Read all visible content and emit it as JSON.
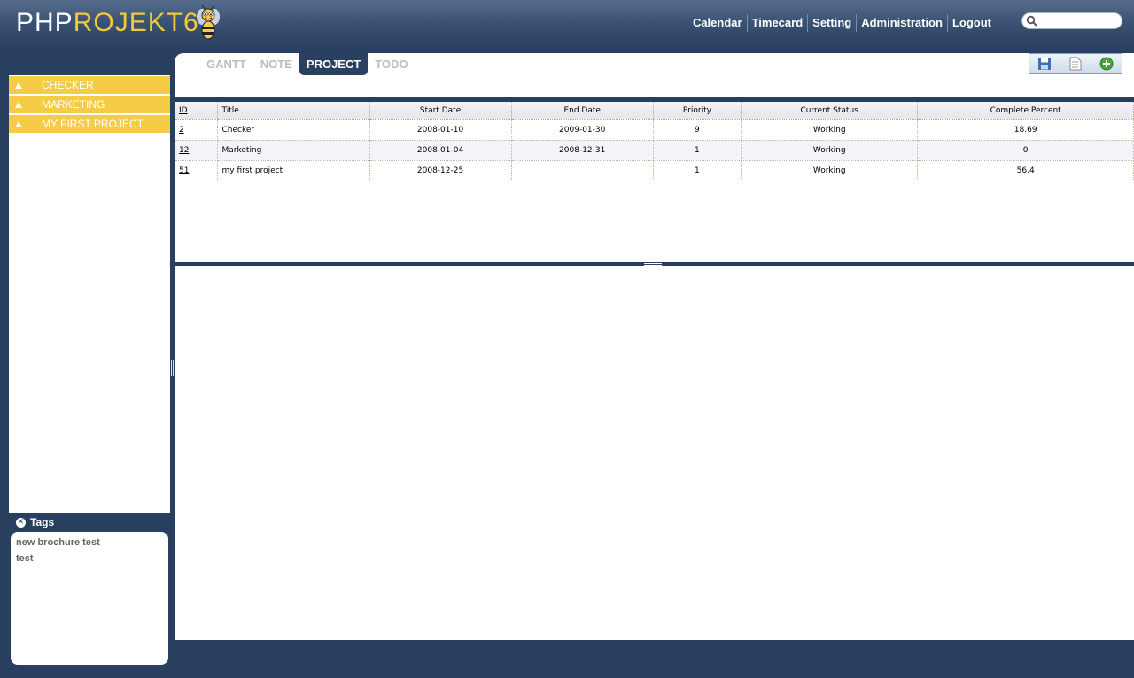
{
  "header": {
    "logo_php": "PHP",
    "logo_projekt": "ROJEKT6",
    "nav": [
      "Calendar",
      "Timecard",
      "Setting",
      "Administration",
      "Logout"
    ],
    "search_value": ""
  },
  "projects": [
    {
      "label": "CHECKER"
    },
    {
      "label": "MARKETING"
    },
    {
      "label": "MY FIRST PROJECT"
    }
  ],
  "tags": {
    "title": "Tags",
    "items": [
      "new brochure test",
      "test"
    ]
  },
  "tabs": [
    {
      "label": "GANTT",
      "active": false
    },
    {
      "label": "NOTE",
      "active": false
    },
    {
      "label": "PROJECT",
      "active": true
    },
    {
      "label": "TODO",
      "active": false
    }
  ],
  "toolbar": {
    "icons": [
      "save-icon",
      "export-icon",
      "add-icon"
    ]
  },
  "grid": {
    "columns": [
      "ID",
      "Title",
      "Start Date",
      "End Date",
      "Priority",
      "Current Status",
      "Complete Percent"
    ],
    "rows": [
      [
        "2",
        "Checker",
        "2008-01-10",
        "2009-01-30",
        "9",
        "Working",
        "18.69"
      ],
      [
        "12",
        "Marketing",
        "2008-01-04",
        "2008-12-31",
        "1",
        "Working",
        "0"
      ],
      [
        "51",
        "my first project",
        "2008-12-25",
        "",
        "1",
        "Working",
        "56.4"
      ]
    ]
  },
  "colors": {
    "background": "#283f5f",
    "accent_yellow": "#f5cc45",
    "tab_active": "#2a4060"
  }
}
